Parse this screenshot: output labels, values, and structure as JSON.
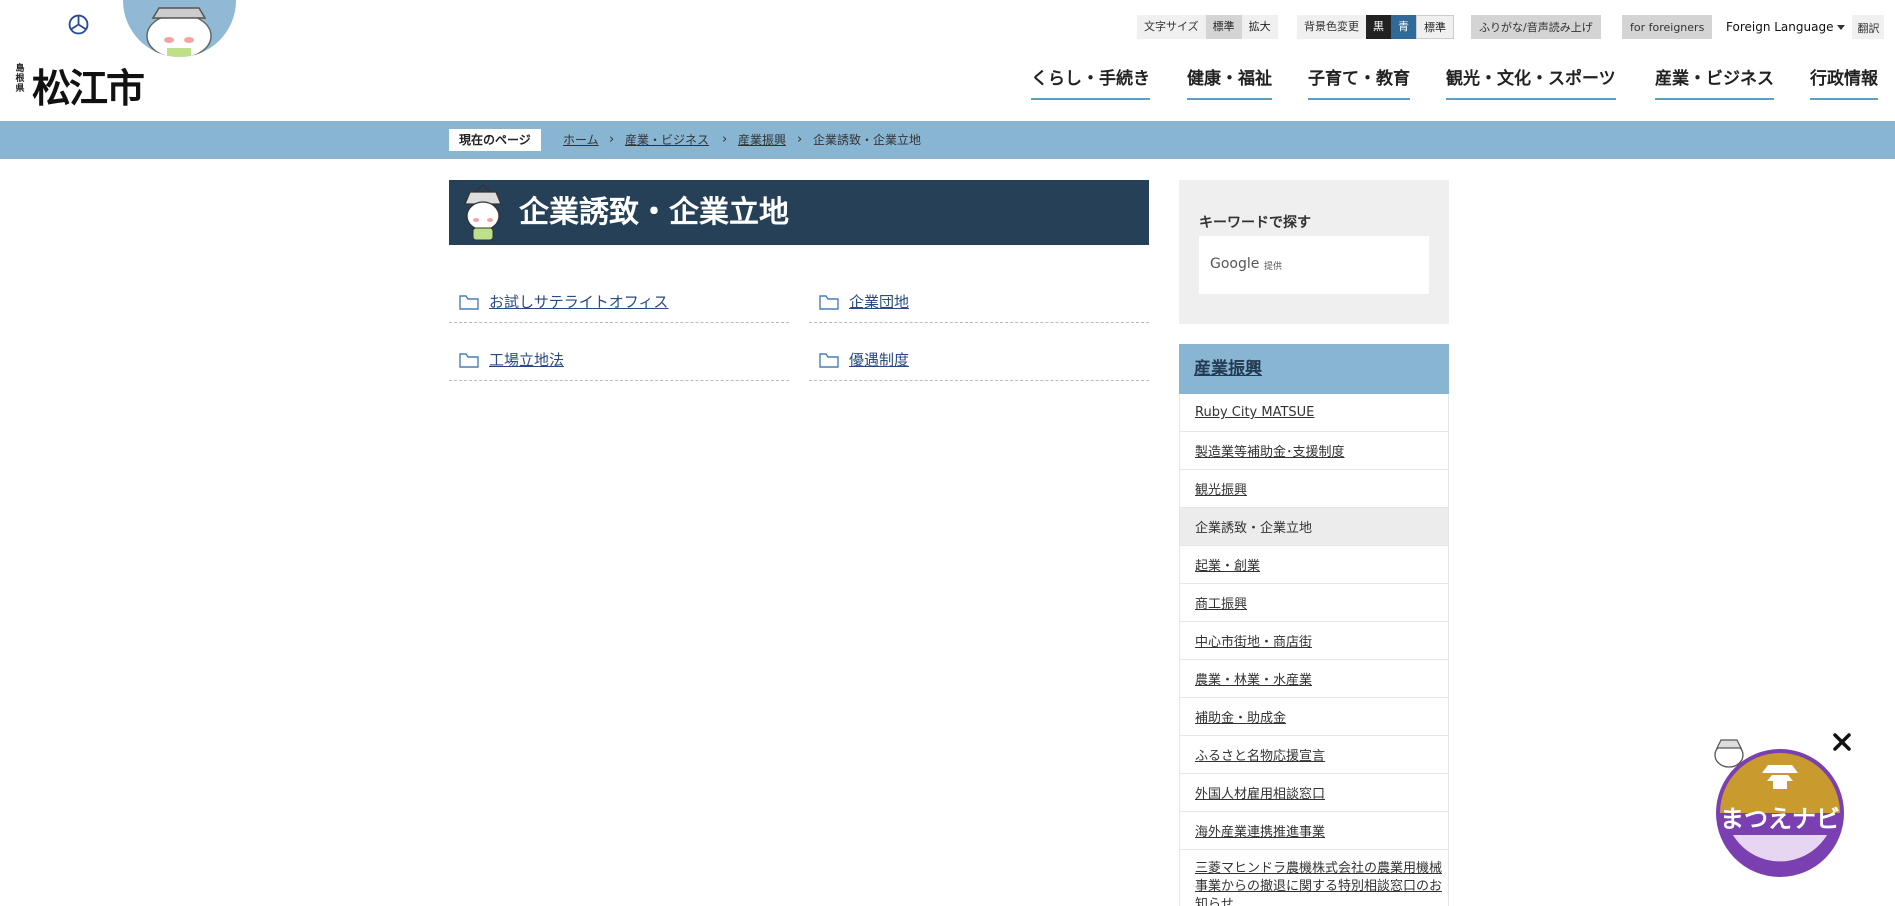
{
  "header": {
    "logo": {
      "prefecture": "島根県",
      "city": "松江市"
    },
    "font_size": {
      "label": "文字サイズ",
      "standard": "標準",
      "large": "拡大"
    },
    "bg_color": {
      "label": "背景色変更",
      "black": "黒",
      "blue": "青",
      "standard": "標準"
    },
    "furigana": "ふりがな/音声読み上げ",
    "foreigners": "for foreigners",
    "language": {
      "label": "Foreign Language",
      "translate": "翻訳"
    },
    "nav": [
      {
        "label": "くらし・手続き"
      },
      {
        "label": "健康・福祉"
      },
      {
        "label": "子育て・教育"
      },
      {
        "label": "観光・文化・スポーツ"
      },
      {
        "label": "産業・ビジネス"
      },
      {
        "label": "行政情報"
      }
    ]
  },
  "breadcrumb": {
    "label": "現在のページ",
    "items": [
      {
        "label": "ホーム"
      },
      {
        "label": "産業・ビジネス"
      },
      {
        "label": "産業振興"
      },
      {
        "label": "企業誘致・企業立地"
      }
    ]
  },
  "main": {
    "title": "企業誘致・企業立地",
    "categories": [
      {
        "label": "お試しサテライトオフィス"
      },
      {
        "label": "企業団地"
      },
      {
        "label": "工場立地法"
      },
      {
        "label": "優遇制度"
      }
    ]
  },
  "sidebar": {
    "search": {
      "title": "キーワードで探す",
      "brand": "Google",
      "provided": "提供"
    },
    "section_title": "産業振興",
    "items": [
      {
        "label": "Ruby City MATSUE"
      },
      {
        "label": "製造業等補助金･支援制度"
      },
      {
        "label": "観光振興"
      },
      {
        "label": "企業誘致・企業立地"
      },
      {
        "label": "起業・創業"
      },
      {
        "label": "商工振興"
      },
      {
        "label": "中心市街地・商店街"
      },
      {
        "label": "農業・林業・水産業"
      },
      {
        "label": "補助金・助成金"
      },
      {
        "label": "ふるさと名物応援宣言"
      },
      {
        "label": "外国人材雇用相談窓口"
      },
      {
        "label": "海外産業連携推進事業"
      },
      {
        "label": "三菱マヒンドラ農機株式会社の農業用機械事業からの撤退に関する特別相談窓口のお知らせ"
      }
    ]
  },
  "floating_nav": {
    "label": "まつえナビ"
  },
  "colors": {
    "accent": "#87b5d2",
    "title_bg": "#264157",
    "link": "#2b4a82",
    "badge_purple": "#7a3fb0",
    "badge_gold": "#c99a2e"
  }
}
